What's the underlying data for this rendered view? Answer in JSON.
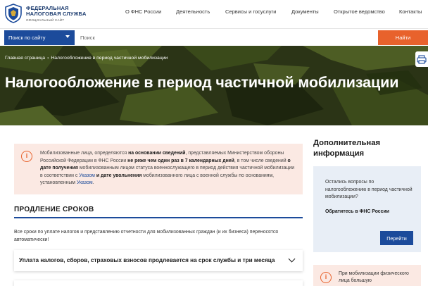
{
  "header": {
    "logo_line1": "ФЕДЕРАЛЬНАЯ",
    "logo_line2": "НАЛОГОВАЯ СЛУЖБА",
    "logo_sub": "ОФИЦИАЛЬНЫЙ САЙТ",
    "nav": [
      "О ФНС России",
      "Деятельность",
      "Сервисы и госуслуги",
      "Документы",
      "Открытое ведомство",
      "Контакты"
    ]
  },
  "search": {
    "scope_label": "Поиск по сайту",
    "placeholder": "Поиск",
    "button_label": "Найти"
  },
  "hero": {
    "breadcrumb_home": "Главная страница",
    "breadcrumb_current": "Налогообложение в период частичной мобилизации",
    "title": "Налогообложение в период частичной мобилизации"
  },
  "alert": {
    "t1": "Мобилизованные лица, определяются ",
    "b1": "на основании сведений",
    "t2": ", представляемых Министерством обороны Российской Федерации в ФНС России ",
    "b2": "не реже чем один раз в 7 календарных дней",
    "t3": ", в том числе сведений ",
    "b3": "о дате получения",
    "t4": " мобилизованным лицом статуса военнослужащего в период действия частичной мобилизации в соответствии с ",
    "link1": "Указом",
    "b4": " и дате увольнения",
    "t5": " мобилизованного лица с военной службы по основаниям, установленным ",
    "link2": "Указом",
    "t6": "."
  },
  "section": {
    "title": "ПРОДЛЕНИЕ СРОКОВ",
    "intro": "Все сроки по уплате налогов и представлению отчетности для мобилизованных граждан (и их бизнеса) переносятся автоматически!",
    "accordion_label": "Уплата налогов, сборов, страховых взносов продлевается на срок службы и три месяца"
  },
  "sidebar": {
    "title_line1": "Дополнительная",
    "title_line2": "информация",
    "question": "Остались вопросы по налогообложению в период частичной мобилизации?",
    "contact": "Обратитесь в ФНС России",
    "button": "Перейти",
    "alert_text": "При мобилизации физического лица большую"
  },
  "colors": {
    "brand_blue": "#1c4b9b",
    "accent_orange": "#e8622c",
    "alert_bg": "#fbe9e3",
    "info_bg": "#e8eef6"
  }
}
